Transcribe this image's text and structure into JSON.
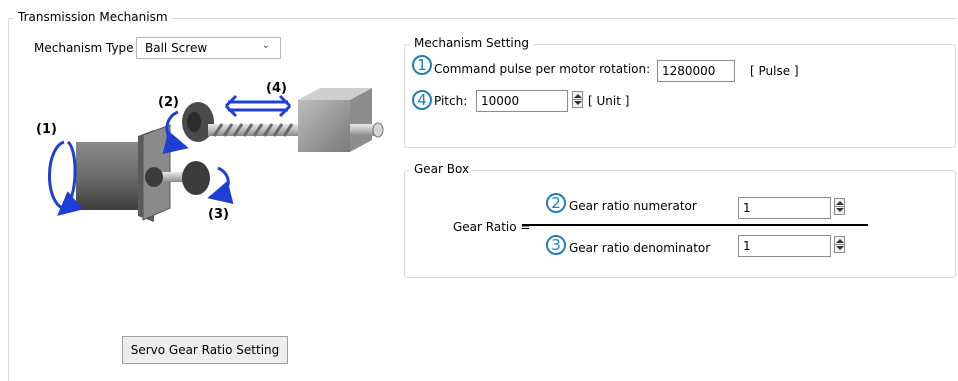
{
  "group": {
    "title": "Transmission Mechanism"
  },
  "mechanism_type": {
    "label": "Mechanism Type",
    "value": "Ball Screw"
  },
  "diagram": {
    "label1": "(1)",
    "label2": "(2)",
    "label3": "(3)",
    "label4": "(4)"
  },
  "mechanism_setting": {
    "title": "Mechanism Setting",
    "marker1": "1",
    "command_pulse_label": "Command pulse per motor rotation:",
    "command_pulse_value": "1280000",
    "command_pulse_unit": "[ Pulse ]",
    "marker4": "4",
    "pitch_label": "Pitch:",
    "pitch_value": "10000",
    "pitch_unit": "[ Unit ]"
  },
  "gear_box": {
    "title": "Gear Box",
    "gear_ratio_label": "Gear Ratio =",
    "marker2": "2",
    "numerator_label": "Gear ratio numerator",
    "numerator_value": "1",
    "marker3": "3",
    "denominator_label": "Gear ratio denominator",
    "denominator_value": "1"
  },
  "buttons": {
    "servo_gear_ratio": "Servo Gear Ratio Setting"
  },
  "colors": {
    "accent": "#1a7fc1",
    "arrow_blue": "#1e3fd6"
  }
}
